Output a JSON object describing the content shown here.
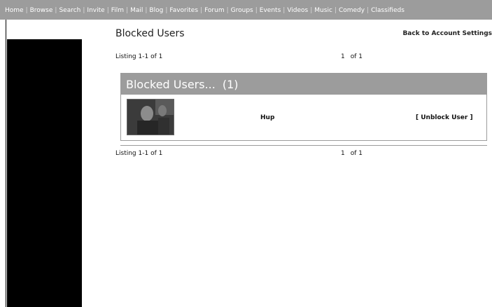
{
  "topnav": {
    "items": [
      "Home",
      "Browse",
      "Search",
      "Invite",
      "Film",
      "Mail",
      "Blog",
      "Favorites",
      "Forum",
      "Groups",
      "Events",
      "Videos",
      "Music",
      "Comedy",
      "Classifieds"
    ]
  },
  "page": {
    "title": "Blocked Users",
    "back_link": "Back to Account Settings"
  },
  "listing_top": {
    "text": "Listing 1-1 of 1",
    "page_num": "1",
    "page_of": "of 1"
  },
  "panel": {
    "header": "Blocked Users...",
    "count": "(1)"
  },
  "blocked_users": [
    {
      "username": "Hup",
      "action": "[ Unblock User ]"
    }
  ],
  "listing_bottom": {
    "text": "Listing 1-1 of 1",
    "page_num": "1",
    "page_of": "of 1"
  }
}
